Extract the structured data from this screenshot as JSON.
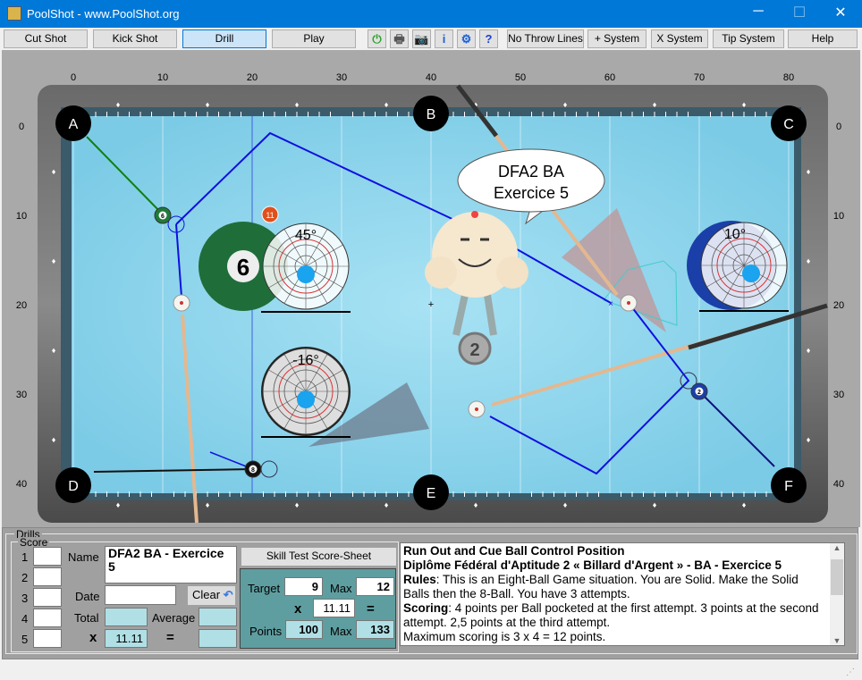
{
  "window": {
    "title": "PoolShot - www.PoolShot.org",
    "minimize": "─",
    "maximize": "☐",
    "close": "✕"
  },
  "toolbar": {
    "buttons": [
      {
        "label": "Cut Shot"
      },
      {
        "label": "Kick Shot"
      },
      {
        "label": "Drill",
        "active": true
      },
      {
        "label": "Play"
      }
    ],
    "icons": [
      {
        "name": "power-icon",
        "glyph": "⏻",
        "color": "#2ca02c"
      },
      {
        "name": "printer-icon",
        "glyph": "🖶",
        "color": "#555"
      },
      {
        "name": "camera-icon",
        "glyph": "📷",
        "color": "#000"
      },
      {
        "name": "info-icon",
        "glyph": "i",
        "color": "#1a5fd6"
      },
      {
        "name": "gear-icon",
        "glyph": "⚙",
        "color": "#1a5fd6"
      },
      {
        "name": "help-doc-icon",
        "glyph": "?",
        "color": "#1a3fd6"
      }
    ],
    "right_buttons": [
      {
        "label": "No Throw Lines"
      },
      {
        "label": "+ System"
      },
      {
        "label": "X System"
      },
      {
        "label": "Tip System"
      },
      {
        "label": "Help"
      }
    ]
  },
  "table": {
    "x_ticks": [
      "0",
      "10",
      "20",
      "30",
      "40",
      "50",
      "60",
      "70",
      "80"
    ],
    "y_ticks": [
      "0",
      "10",
      "20",
      "30",
      "40"
    ],
    "pockets": [
      "A",
      "B",
      "C",
      "D",
      "E",
      "F"
    ],
    "balls": [
      {
        "id": "6",
        "x": 10,
        "y": 10,
        "color": "#1e7b3a"
      },
      {
        "id": "cue",
        "x": 12.1,
        "y": 19.8
      },
      {
        "id": "cue",
        "x": 62.1,
        "y": 19.8
      },
      {
        "id": "2",
        "x": 70,
        "y": 29.7,
        "color": "#1b3fa8"
      },
      {
        "id": "8",
        "x": 20.1,
        "y": 38.4,
        "color": "#111"
      },
      {
        "id": "cue",
        "x": 45.1,
        "y": 31.7
      }
    ],
    "ball_icon_11": "11",
    "angles": [
      "45°",
      "-16°",
      "10°"
    ],
    "bubble": {
      "line1": "DFA2 BA",
      "line2": "Exercice 5"
    },
    "medal": "2",
    "colors": {
      "felt": "#8fd3ec",
      "rail": "#5a5a5a",
      "path": "#1010e0",
      "green_line": "#108010"
    }
  },
  "drills": {
    "group_label": "Drills",
    "score_label": "Score",
    "rows": [
      "1",
      "2",
      "3",
      "4",
      "5"
    ],
    "name_label": "Name",
    "name_value": "DFA2 BA - Exercice 5",
    "date_label": "Date",
    "date_value": "",
    "clear_label": "Clear",
    "total_label": "Total",
    "total_value": "",
    "average_label": "Average",
    "average_value": "",
    "x_label": "x",
    "x_value": "11.11",
    "eq_label": "=",
    "result_value": "",
    "score_sheet_label": "Skill Test Score-Sheet",
    "target_label": "Target",
    "target_value": "9",
    "max_label": "Max",
    "max_value": "12",
    "mult_label": "x",
    "mult_value": "11.11",
    "mult_eq": "=",
    "points_label": "Points",
    "points_value": "100",
    "points_max_label": "Max",
    "points_max_value": "133"
  },
  "description": {
    "title": "Run Out and Cue Ball Control Position",
    "subtitle": "Diplôme Fédéral d'Aptitude 2 « Billard d'Argent » - BA - Exercice 5",
    "rules_label": "Rules",
    "rules_text": ": This is an Eight-Ball Game situation. You are Solid. Make the Solid Balls then the 8-Ball. You have 3 attempts.",
    "scoring_label": "Scoring",
    "scoring_text": ": 4 points per Ball pocketed at the first attempt. 3 points at the second attempt. 2,5 points at the third attempt.",
    "max_text": "Maximum scoring is 3 x 4 = 12 points."
  }
}
